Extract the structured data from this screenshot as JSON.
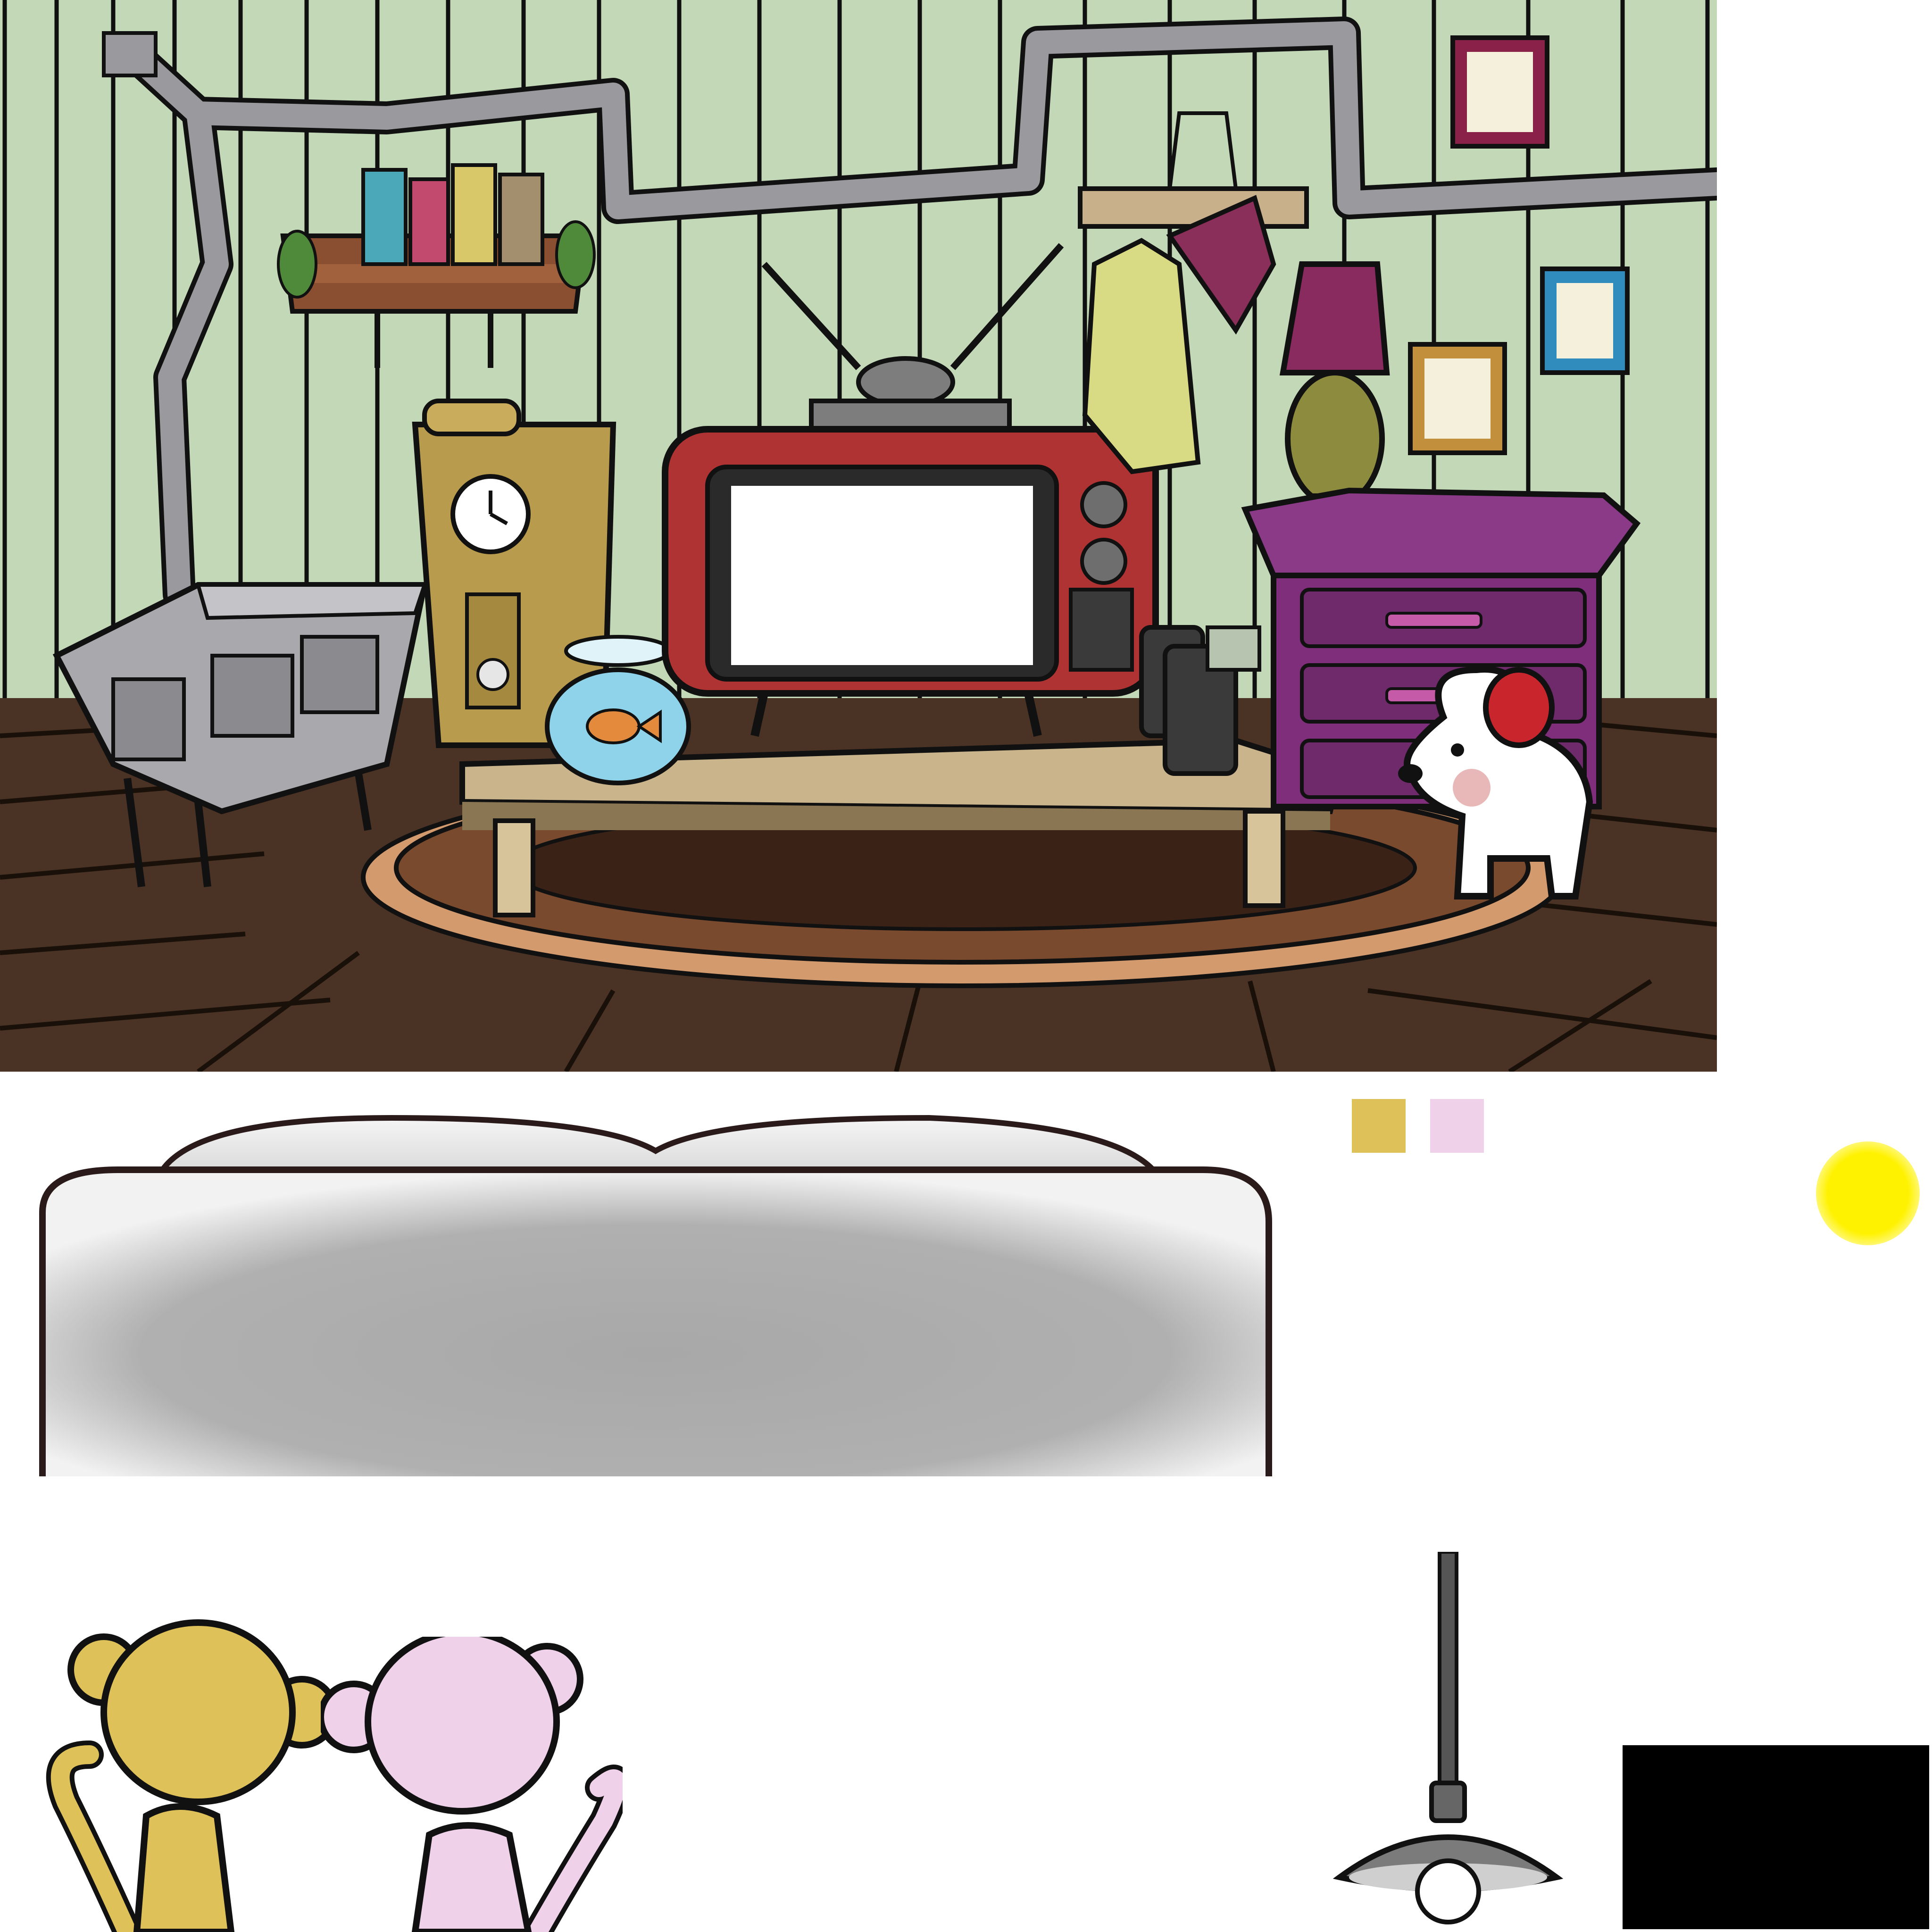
{
  "scene": {
    "kind": "game-asset-sheet",
    "background_panel": "living-room",
    "wall_color": "#c2d8b7",
    "wall_stripe_color": "#101010",
    "floor_color": "#4a3324",
    "rug_color": "#7a4a2e",
    "rug_fringe_color": "#d39a6e"
  },
  "room_objects": [
    {
      "name": "wood-stove",
      "color": "#a9a9ad"
    },
    {
      "name": "stove-pipe",
      "color": "#9a9a9e"
    },
    {
      "name": "book-shelf",
      "color": "#8a4f31"
    },
    {
      "name": "books",
      "colors": [
        "#4aa8b8",
        "#c24a6f",
        "#d8c86a",
        "#a38e6d"
      ]
    },
    {
      "name": "grandfather-clock",
      "color": "#b89b4d"
    },
    {
      "name": "fishbowl",
      "color": "#8fd3ea"
    },
    {
      "name": "goldfish",
      "color": "#e38a3c"
    },
    {
      "name": "retro-tv",
      "color": "#b03333"
    },
    {
      "name": "tv-screen",
      "color": "#ffffff"
    },
    {
      "name": "coffee-table",
      "color": "#c9b48c"
    },
    {
      "name": "speakers",
      "color": "#3a3a3a"
    },
    {
      "name": "coat-rack",
      "color": "#c8b08a"
    },
    {
      "name": "coat",
      "color": "#d8da84"
    },
    {
      "name": "umbrella",
      "color": "#8a2f5a"
    },
    {
      "name": "lamp",
      "color": "#8a2b5f"
    },
    {
      "name": "dresser",
      "color": "#7e2e7a"
    },
    {
      "name": "white-dog",
      "color": "#ffffff"
    },
    {
      "name": "dog-headphones",
      "color": "#c8262c"
    },
    {
      "name": "picture-frames",
      "colors": [
        "#8a2148",
        "#2f8cbc",
        "#c28f3d"
      ]
    }
  ],
  "sofa": {
    "name": "sofa-back",
    "color": "#d5d5d5"
  },
  "swatches": [
    {
      "name": "swatch-gold",
      "color": "#dfc15a"
    },
    {
      "name": "swatch-pink",
      "color": "#efd2ea"
    }
  ],
  "glow": {
    "name": "yellow-glow",
    "color": "#fff200"
  },
  "characters": [
    {
      "name": "monkey-gold",
      "color": "#dfc15a"
    },
    {
      "name": "monkey-pink",
      "color": "#efd2ea"
    }
  ],
  "ceiling_lamp": {
    "name": "hanging-lamp",
    "shade_color": "#7b7b7b",
    "bulb_color": "#ffffff"
  },
  "black_block": {
    "name": "black-rect",
    "color": "#000000"
  }
}
